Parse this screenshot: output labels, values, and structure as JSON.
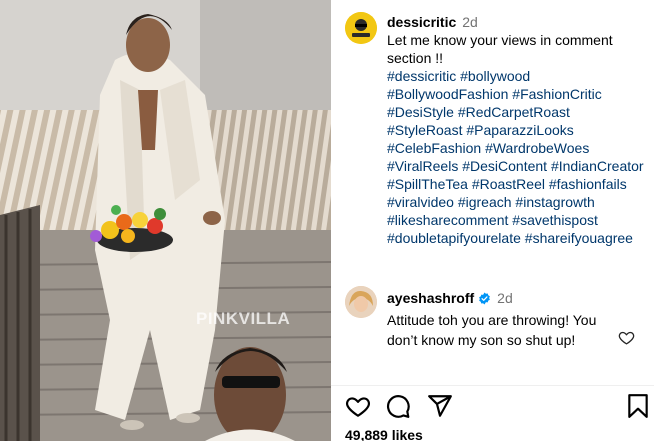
{
  "media": {
    "watermark": "PINKVILLA"
  },
  "post": {
    "username": "dessicritic",
    "time": "2d",
    "caption": "Let me know your views in comment section !!",
    "hashtags": [
      "#dessicritic",
      "#bollywood",
      "#BollywoodFashion",
      "#FashionCritic",
      "#DesiStyle",
      "#RedCarpetRoast",
      "#StyleRoast",
      "#PaparazziLooks",
      "#CelebFashion",
      "#WardrobeWoes",
      "#ViralReels",
      "#DesiContent",
      "#IndianCreator",
      "#SpillTheTea",
      "#RoastReel",
      "#fashionfails",
      "#viralvideo",
      "#igreach",
      "#instagrowth",
      "#likesharecomment",
      "#savethispost",
      "#doubletapifyourelate",
      "#shareifyouagree"
    ]
  },
  "comment": {
    "username": "ayeshashroff",
    "verified": true,
    "time": "2d",
    "text": "Attitude toh you are throwing! You don’t know my son so shut up!"
  },
  "actions": {
    "like_icon": "heart-icon",
    "comment_icon": "comment-bubble-icon",
    "share_icon": "paper-plane-icon",
    "save_icon": "bookmark-icon"
  },
  "likes": "49,889 likes",
  "colors": {
    "hashtag": "#00376b",
    "timestamp": "#737373",
    "verified": "#0095f6"
  }
}
